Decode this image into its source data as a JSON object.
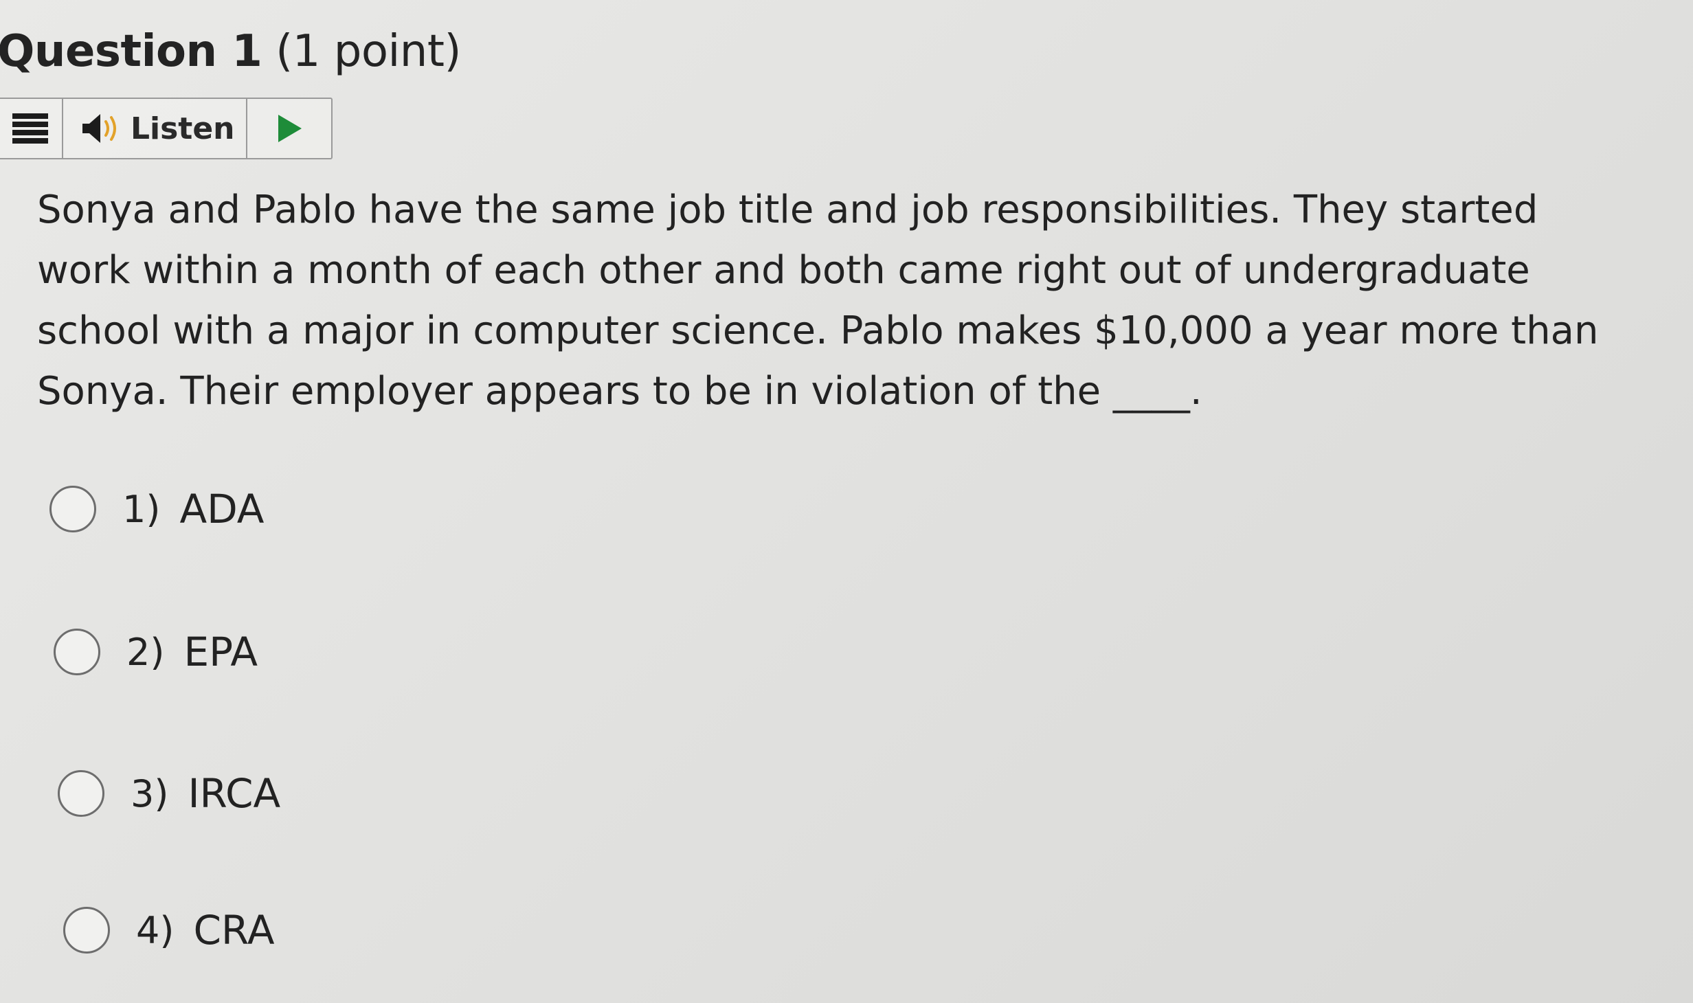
{
  "question": {
    "title": "Question 1",
    "points": "(1 point)",
    "text": "Sonya and Pablo have the same job title and job responsibilities. They started work within a month of each other and both came right out of undergraduate school with a major in computer science. Pablo makes $10,000 a year more than Sonya. Their employer appears to be in violation of the ____."
  },
  "toolbar": {
    "menu_icon": "menu-icon",
    "listen_icon": "speaker-icon",
    "listen_label": "Listen",
    "play_icon": "play-icon",
    "play_color": "#1e8c39"
  },
  "options": [
    {
      "number": "1)",
      "label": "ADA"
    },
    {
      "number": "2)",
      "label": "EPA"
    },
    {
      "number": "3)",
      "label": "IRCA"
    },
    {
      "number": "4)",
      "label": "CRA"
    }
  ]
}
